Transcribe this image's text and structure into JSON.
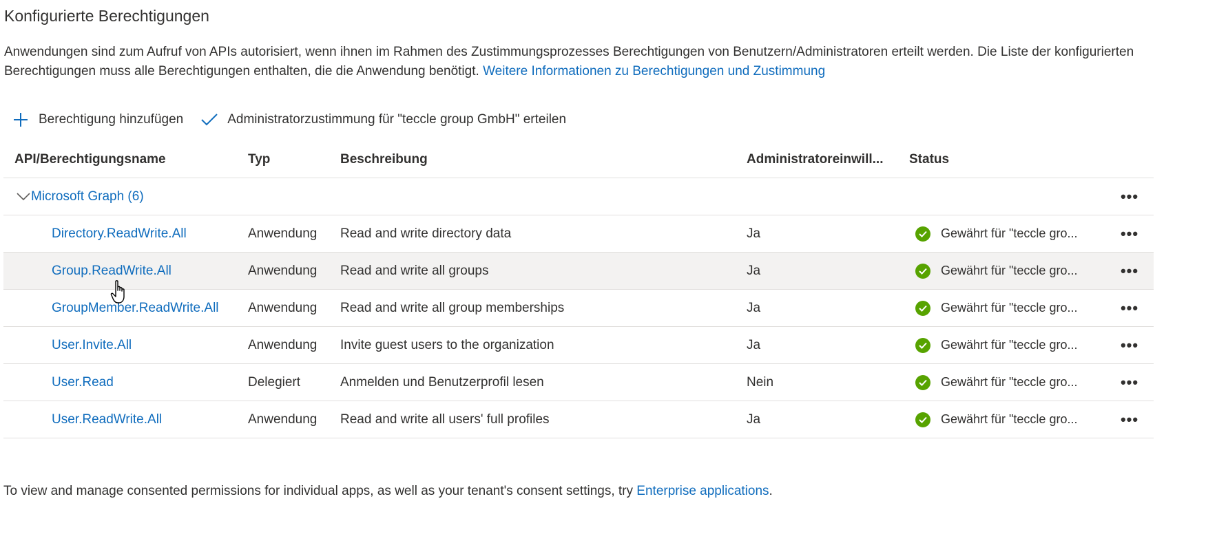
{
  "page": {
    "title": "Konfigurierte Berechtigungen",
    "intro_text": "Anwendungen sind zum Aufruf von APIs autorisiert, wenn ihnen im Rahmen des Zustimmungsprozesses Berechtigungen von Benutzern/Administratoren erteilt werden. Die Liste der konfigurierten Berechtigungen muss alle Berechtigungen enthalten, die die Anwendung benötigt.",
    "intro_link": "Weitere Informationen zu Berechtigungen und Zustimmung"
  },
  "toolbar": {
    "add_label": "Berechtigung hinzufügen",
    "add_icon": "plus-icon",
    "consent_label": "Administratorzustimmung für \"teccle group GmbH\" erteilen",
    "consent_icon": "checkmark-icon"
  },
  "table": {
    "headers": [
      "API/Berechtigungsname",
      "Typ",
      "Beschreibung",
      "Administratoreinwill...",
      "Status"
    ],
    "group": {
      "label": "Microsoft Graph (6)",
      "expanded": true,
      "more": "•••"
    },
    "rows": [
      {
        "name": "Directory.ReadWrite.All",
        "type": "Anwendung",
        "description": "Read and write directory data",
        "admin": "Ja",
        "status": "Gewährt für \"teccle gro...",
        "more": "•••"
      },
      {
        "name": "Group.ReadWrite.All",
        "type": "Anwendung",
        "description": "Read and write all groups",
        "admin": "Ja",
        "status": "Gewährt für \"teccle gro...",
        "more": "•••"
      },
      {
        "name": "GroupMember.ReadWrite.All",
        "type": "Anwendung",
        "description": "Read and write all group memberships",
        "admin": "Ja",
        "status": "Gewährt für \"teccle gro...",
        "more": "•••"
      },
      {
        "name": "User.Invite.All",
        "type": "Anwendung",
        "description": "Invite guest users to the organization",
        "admin": "Ja",
        "status": "Gewährt für \"teccle gro...",
        "more": "•••"
      },
      {
        "name": "User.Read",
        "type": "Delegiert",
        "description": "Anmelden und Benutzerprofil lesen",
        "admin": "Nein",
        "status": "Gewährt für \"teccle gro...",
        "more": "•••"
      },
      {
        "name": "User.ReadWrite.All",
        "type": "Anwendung",
        "description": "Read and write all users' full profiles",
        "admin": "Ja",
        "status": "Gewährt für \"teccle gro...",
        "more": "•••"
      }
    ]
  },
  "footer": {
    "text": "To view and manage consented permissions for individual apps, as well as your tenant's consent settings, try",
    "link": "Enterprise applications",
    "end": "."
  },
  "colors": {
    "link": "#0f6cbd",
    "success": "#57a300",
    "row_hover": "#f3f2f1",
    "divider": "#e1dfdd"
  }
}
